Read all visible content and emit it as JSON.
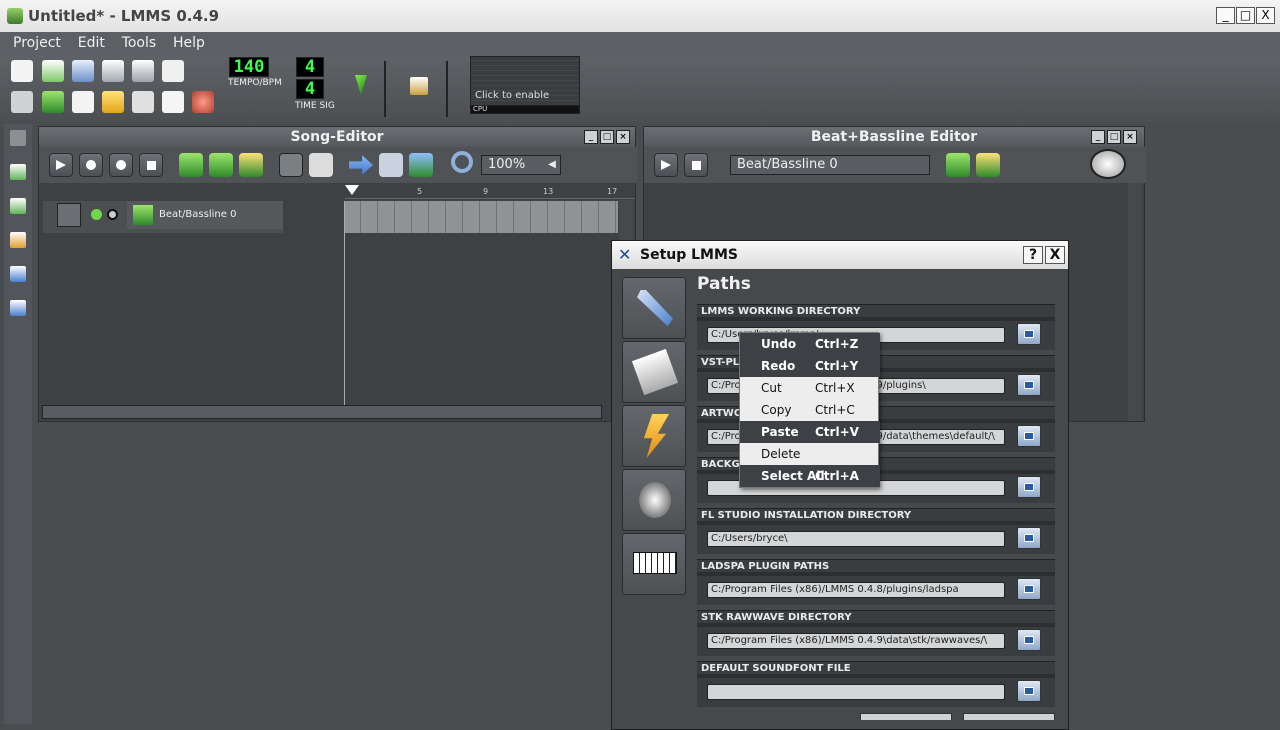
{
  "window": {
    "title": "Untitled* - LMMS 0.4.9",
    "min": "_",
    "max": "□",
    "close": "X"
  },
  "menu": [
    "Project",
    "Edit",
    "Tools",
    "Help"
  ],
  "transport": {
    "tempo": "140",
    "tempo_label": "TEMPO/BPM",
    "timesig_num": "4",
    "timesig_den": "4",
    "timesig_label": "TIME SIG",
    "cpu_hint": "Click to enable",
    "cpu_label": "CPU"
  },
  "song_editor": {
    "title": "Song-Editor",
    "zoom": "100%",
    "track_name": "Beat/Bassline 0",
    "ruler": [
      "5",
      "9",
      "13",
      "17"
    ]
  },
  "bb_editor": {
    "title": "Beat+Bassline Editor",
    "selected": "Beat/Bassline 0"
  },
  "dialog": {
    "title": "Setup LMMS",
    "help": "?",
    "close": "X",
    "section": "Paths",
    "groups": [
      {
        "label": "LMMS WORKING DIRECTORY",
        "value": "C:/Users/bryce/lmms/"
      },
      {
        "label": "VST-PLUGIN DIRECTORY",
        "value": "C:/Program Files (x86)/LMMS 0.4.9/plugins\\"
      },
      {
        "label": "ARTWORK DIRECTORY",
        "value": "C:/Program Files (x86)/LMMS 0.4.9/data\\themes\\default/\\"
      },
      {
        "label": "BACKGROUND ARTWORK",
        "value": ""
      },
      {
        "label": "FL STUDIO INSTALLATION DIRECTORY",
        "value": "C:/Users/bryce\\"
      },
      {
        "label": "LADSPA PLUGIN PATHS",
        "value": "C:/Program Files (x86)/LMMS 0.4.8/plugins/ladspa"
      },
      {
        "label": "STK RAWWAVE DIRECTORY",
        "value": "C:/Program Files (x86)/LMMS 0.4.9\\data\\stk/rawwaves/\\"
      },
      {
        "label": "DEFAULT SOUNDFONT FILE",
        "value": ""
      }
    ]
  },
  "context_menu": [
    {
      "label": "Undo",
      "shortcut": "Ctrl+Z",
      "highlight": true
    },
    {
      "label": "Redo",
      "shortcut": "Ctrl+Y",
      "highlight": true
    },
    {
      "label": "Cut",
      "shortcut": "Ctrl+X",
      "highlight": false
    },
    {
      "label": "Copy",
      "shortcut": "Ctrl+C",
      "highlight": false
    },
    {
      "label": "Paste",
      "shortcut": "Ctrl+V",
      "highlight": true
    },
    {
      "label": "Delete",
      "shortcut": "",
      "highlight": false
    },
    {
      "label": "Select All",
      "shortcut": "Ctrl+A",
      "highlight": true
    }
  ]
}
